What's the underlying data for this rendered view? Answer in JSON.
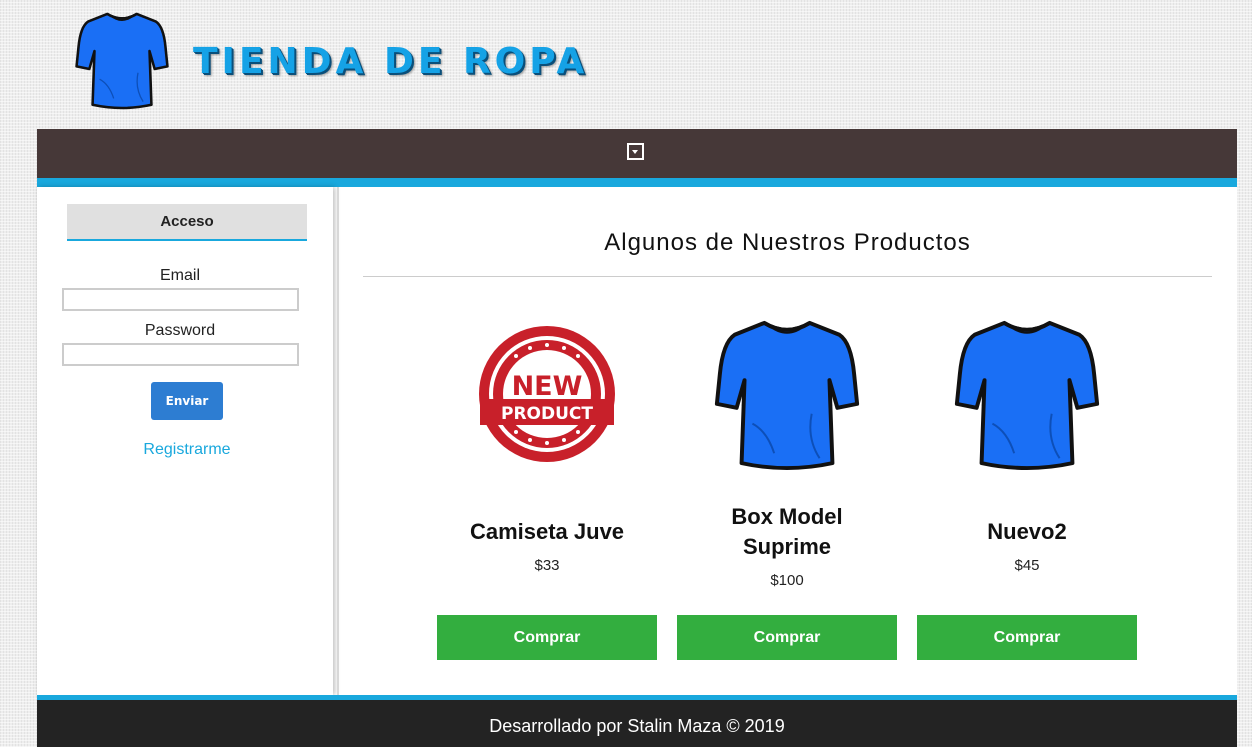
{
  "header": {
    "title": "TIENDA DE ROPA",
    "logo_icon": "tshirt-icon"
  },
  "nav": {
    "menu_icon": "dropdown-menu-icon"
  },
  "login": {
    "heading": "Acceso",
    "email_label": "Email",
    "email_value": "",
    "password_label": "Password",
    "password_value": "",
    "submit_label": "Enviar",
    "register_label": "Registrarme"
  },
  "products": {
    "heading": "Algunos de Nuestros Productos",
    "items": [
      {
        "name": "Camiseta Juve",
        "price": "$33",
        "image": "new-product-stamp",
        "buy_label": "Comprar"
      },
      {
        "name": "Box Model Suprime",
        "price": "$100",
        "image": "blue-tshirt",
        "buy_label": "Comprar"
      },
      {
        "name": "Nuevo2",
        "price": "$45",
        "image": "blue-tshirt",
        "buy_label": "Comprar"
      }
    ]
  },
  "footer": {
    "text": "Desarrollado por Stalin Maza © 2019"
  },
  "colors": {
    "accent": "#19a8dd",
    "navbar": "#463838",
    "buy_button": "#33ae3f",
    "send_button": "#2d7dd2",
    "shirt": "#1a6ff5",
    "footer": "#232323"
  }
}
